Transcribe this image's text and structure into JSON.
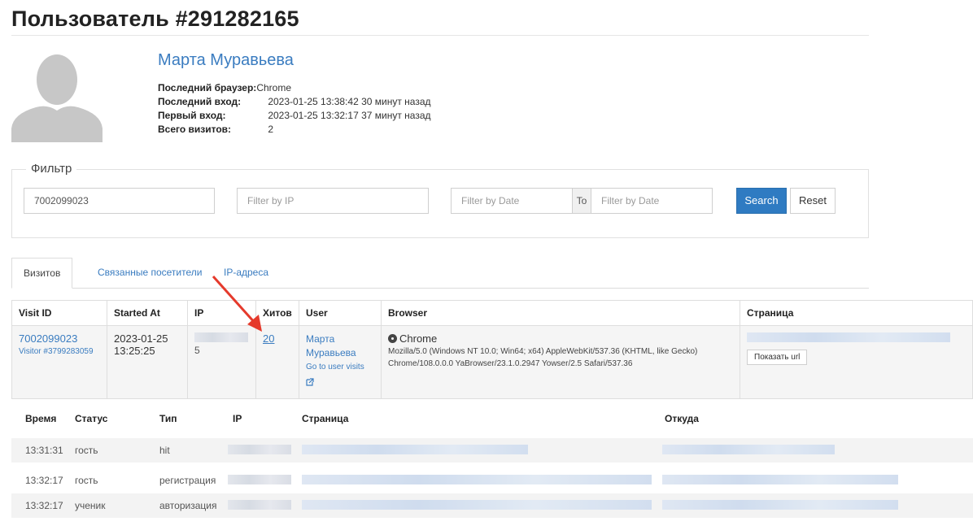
{
  "page": {
    "title": "Пользователь #291282165"
  },
  "profile": {
    "name": "Марта Муравьева",
    "fields": [
      {
        "label": "Последний браузер:",
        "value": "Chrome"
      },
      {
        "label": "Последний вход:",
        "value": "2023-01-25 13:38:42 30 минут назад"
      },
      {
        "label": "Первый вход:",
        "value": "2023-01-25 13:32:17 37 минут назад"
      },
      {
        "label": "Всего визитов:",
        "value": "2"
      }
    ]
  },
  "filter": {
    "legend": "Фильтр",
    "visit_value": "7002099023",
    "ip_placeholder": "Filter by IP",
    "date_from_placeholder": "Filter by Date",
    "to_label": "To",
    "date_to_placeholder": "Filter by Date",
    "search_label": "Search",
    "reset_label": "Reset"
  },
  "tabs": [
    {
      "label": "Визитов",
      "active": true
    },
    {
      "label": "Связанные посетители",
      "active": false
    },
    {
      "label": "IP-адреса",
      "active": false
    }
  ],
  "visits_table": {
    "headers": [
      "Visit ID",
      "Started At",
      "IP",
      "Хитов",
      "User",
      "Browser",
      "Страница"
    ],
    "row": {
      "visit_id": "7002099023",
      "visitor": "Visitor #3799283059",
      "started_date": "2023-01-25",
      "started_time": "13:25:25",
      "ip_tail": "5",
      "hits": "20",
      "user_first": "Марта",
      "user_last": "Муравьева",
      "go_to_visits": "Go to user visits",
      "browser_name": "Chrome",
      "user_agent_1": "Mozilla/5.0 (Windows NT 10.0; Win64; x64) AppleWebKit/537.36 (KHTML, like Gecko)",
      "user_agent_2": "Chrome/108.0.0.0 YaBrowser/23.1.0.2947 Yowser/2.5 Safari/537.36",
      "show_url": "Показать url"
    }
  },
  "hits_table": {
    "headers": [
      "Время",
      "Статус",
      "Тип",
      "IP",
      "Страница",
      "Откуда"
    ],
    "rows": [
      {
        "time": "13:31:31",
        "status": "гость",
        "type": "hit"
      },
      {
        "time": "13:32:17",
        "status": "гость",
        "type": "регистрация"
      },
      {
        "time": "13:32:17",
        "status": "ученик",
        "type": "авторизация"
      }
    ]
  },
  "colors": {
    "link": "#3a7cc0",
    "primary_button": "#2f7bc2",
    "arrow": "#e53a2c"
  }
}
